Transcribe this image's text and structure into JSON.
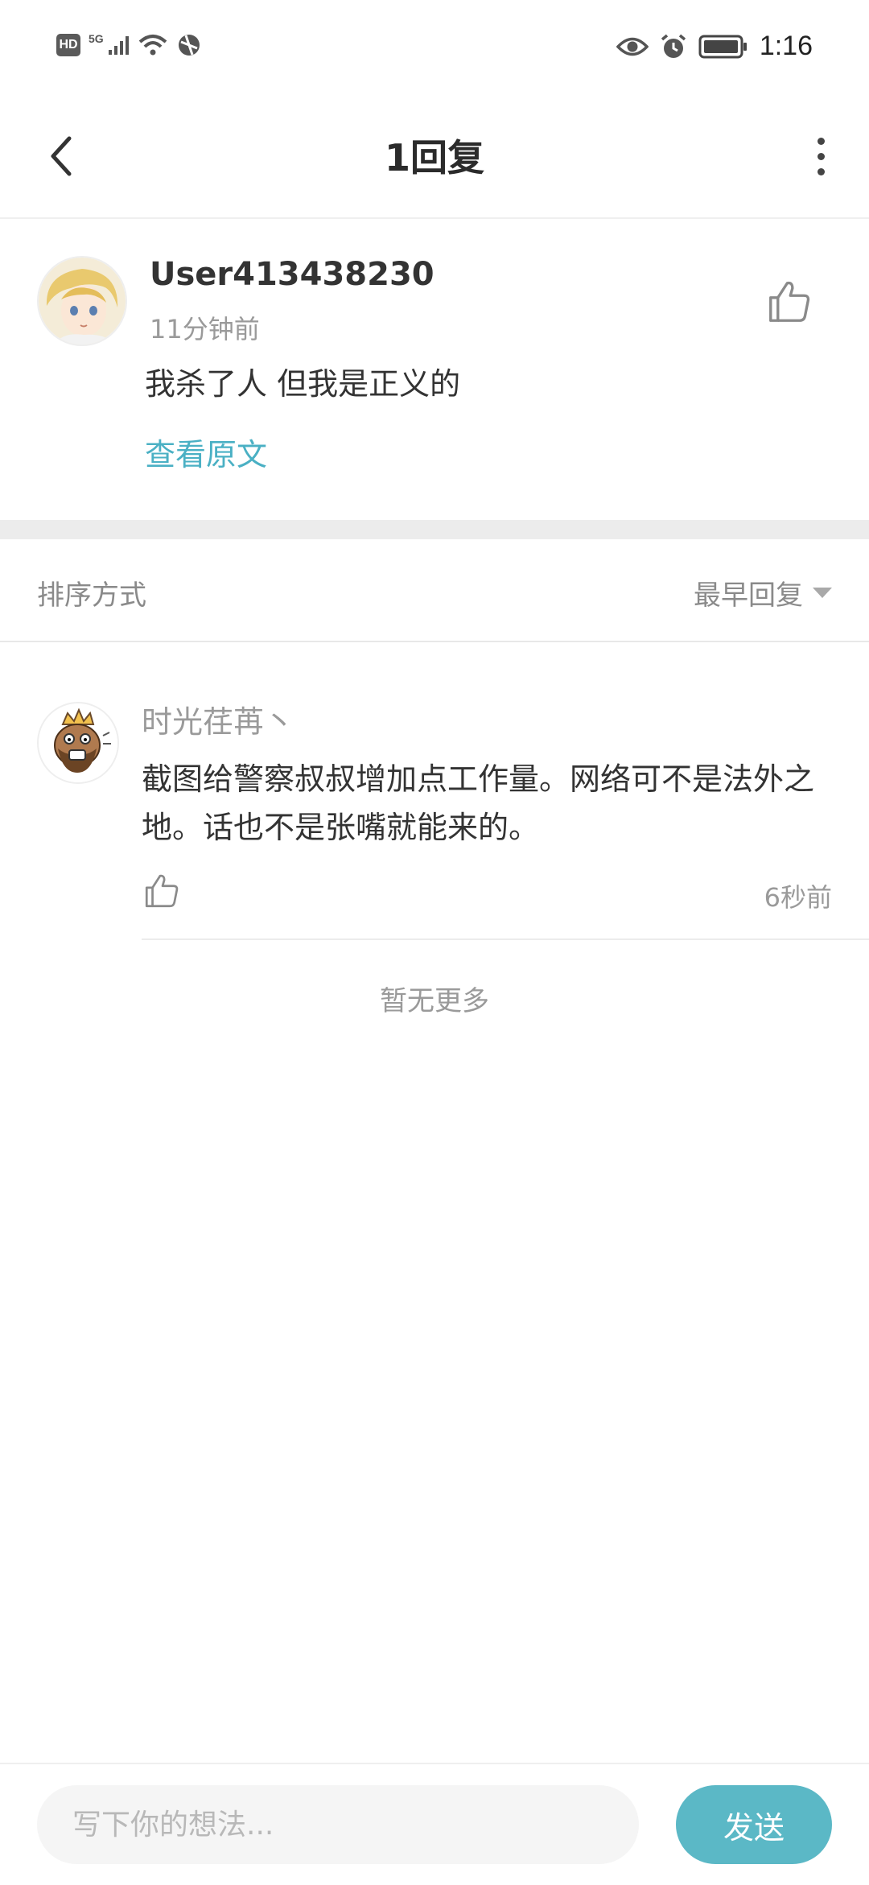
{
  "status_bar": {
    "hd": "HD",
    "network": "5G",
    "time": "1:16",
    "icons": [
      "signal-icon",
      "wifi-icon",
      "vpn-icon",
      "eye-icon",
      "alarm-icon",
      "battery-icon"
    ]
  },
  "nav": {
    "title": "1回复",
    "back_icon": "chevron-left-icon",
    "more_icon": "more-vertical-icon"
  },
  "post": {
    "username": "User413438230",
    "time": "11分钟前",
    "content": "我杀了人 但我是正义的",
    "view_original": "查看原文",
    "like_icon": "thumbs-up-icon"
  },
  "sort": {
    "label": "排序方式",
    "selected": "最早回复"
  },
  "replies": [
    {
      "username": "时光荏苒丶",
      "content": "截图给警察叔叔增加点工作量。网络可不是法外之地。话也不是张嘴就能来的。",
      "time": "6秒前"
    }
  ],
  "footer_text": "暂无更多",
  "composer": {
    "placeholder": "写下你的想法...",
    "send_label": "发送"
  },
  "colors": {
    "accent": "#4ab0c4",
    "send_button": "#5bb8c6",
    "divider": "#ececec"
  }
}
